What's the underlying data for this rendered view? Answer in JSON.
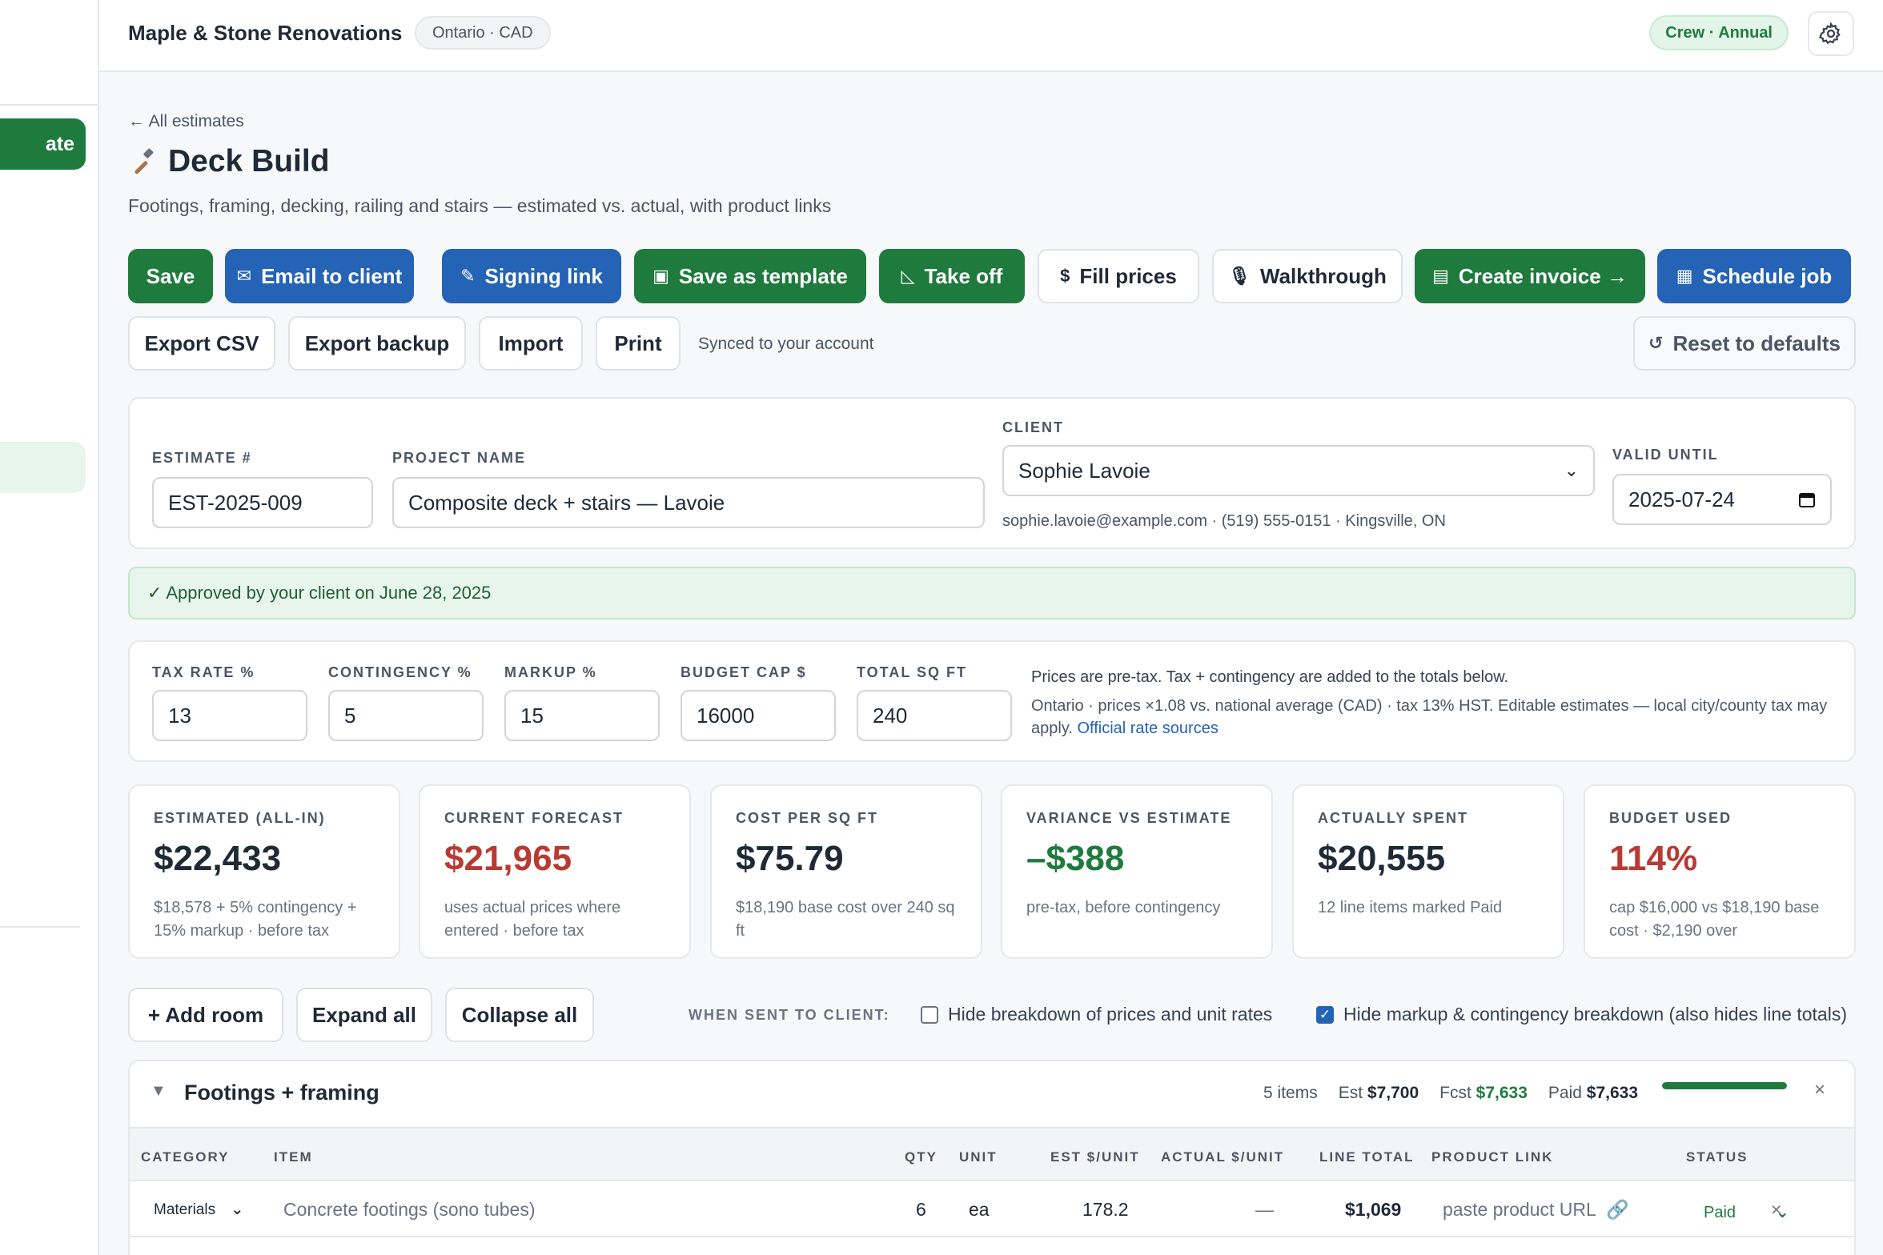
{
  "sidebar": {
    "new_label": "ate"
  },
  "topbar": {
    "brand": "Maple & Stone Renovations",
    "region": "Ontario · CAD",
    "plan": "Crew · Annual"
  },
  "page": {
    "back": "← All estimates",
    "title": "Deck Build",
    "subtitle": "Footings, framing, decking, railing and stairs — estimated vs. actual, with product links"
  },
  "actions": {
    "save": "Save",
    "email": "Email to client",
    "signing": "Signing link",
    "template": "Save as template",
    "takeoff": "Take off",
    "fill": "Fill prices",
    "walkthrough": "Walkthrough",
    "invoice": "Create invoice →",
    "schedule": "Schedule job",
    "export_csv": "Export CSV",
    "export_backup": "Export backup",
    "import": "Import",
    "print": "Print",
    "synced": "Synced to your account",
    "reset": "Reset to defaults"
  },
  "details": {
    "estimate_label": "Estimate #",
    "estimate_value": "EST-2025-009",
    "project_label": "Project name",
    "project_value": "Composite deck + stairs — Lavoie",
    "client_label": "Client",
    "client_value": "Sophie Lavoie",
    "client_info": "sophie.lavoie@example.com · (519) 555-0151 · Kingsville, ON",
    "valid_label": "Valid until",
    "valid_value": "2025-07-24"
  },
  "approval": "✓ Approved by your client on June 28, 2025",
  "rates": {
    "tax_label": "Tax rate %",
    "tax_value": "13",
    "contingency_label": "Contingency %",
    "contingency_value": "5",
    "markup_label": "Markup %",
    "markup_value": "15",
    "budget_label": "Budget cap $",
    "budget_value": "16000",
    "sqft_label": "Total sq ft",
    "sqft_value": "240",
    "note1": "Prices are pre-tax. Tax + contingency are added to the totals below.",
    "note2": "Ontario · prices ×1.08 vs. national average (CAD) · tax 13% HST. Editable estimates — local city/county tax may apply.",
    "note_link": "Official rate sources"
  },
  "stats": [
    {
      "label": "ESTIMATED (ALL-IN)",
      "value": "$22,433",
      "sub": "$18,578 + 5% contingency + 15% markup · before tax"
    },
    {
      "label": "CURRENT FORECAST",
      "value": "$21,965",
      "sub": "uses actual prices where entered · before tax"
    },
    {
      "label": "COST PER SQ FT",
      "value": "$75.79",
      "sub": "$18,190 base cost over 240 sq ft"
    },
    {
      "label": "VARIANCE VS ESTIMATE",
      "value": "–$388",
      "sub": "pre-tax, before contingency"
    },
    {
      "label": "ACTUALLY SPENT",
      "value": "$20,555",
      "sub": "12 line items marked Paid"
    },
    {
      "label": "BUDGET USED",
      "value": "114%",
      "sub": "cap $16,000 vs $18,190 base cost · $2,190 over"
    }
  ],
  "rooms_toolbar": {
    "add": "+ Add room",
    "expand": "Expand all",
    "collapse": "Collapse all",
    "when_label": "WHEN SENT TO CLIENT:",
    "hide_prices": "Hide breakdown of prices and unit rates",
    "hide_markup": "Hide markup & contingency breakdown (also hides line totals)"
  },
  "room": {
    "name": "Footings + framing",
    "items": "5 items",
    "est_label": "Est",
    "est_value": "$7,700",
    "fcst_label": "Fcst",
    "fcst_value": "$7,633",
    "paid_label": "Paid",
    "paid_value": "$7,633",
    "progress": 1.0,
    "columns": [
      "CATEGORY",
      "ITEM",
      "QTY",
      "UNIT",
      "EST $/UNIT",
      "ACTUAL $/UNIT",
      "LINE TOTAL",
      "PRODUCT LINK",
      "STATUS"
    ],
    "rows": [
      {
        "category": "Materials",
        "item": "Concrete footings (sono tubes)",
        "qty": "6",
        "unit": "ea",
        "est": "178.2",
        "actual": "—",
        "total": "$1,069",
        "link_placeholder": "paste product URL",
        "status": "Paid"
      }
    ]
  },
  "colors": {
    "green": "#1f7a3d",
    "blue": "#2463b5",
    "red": "#b93a32"
  }
}
